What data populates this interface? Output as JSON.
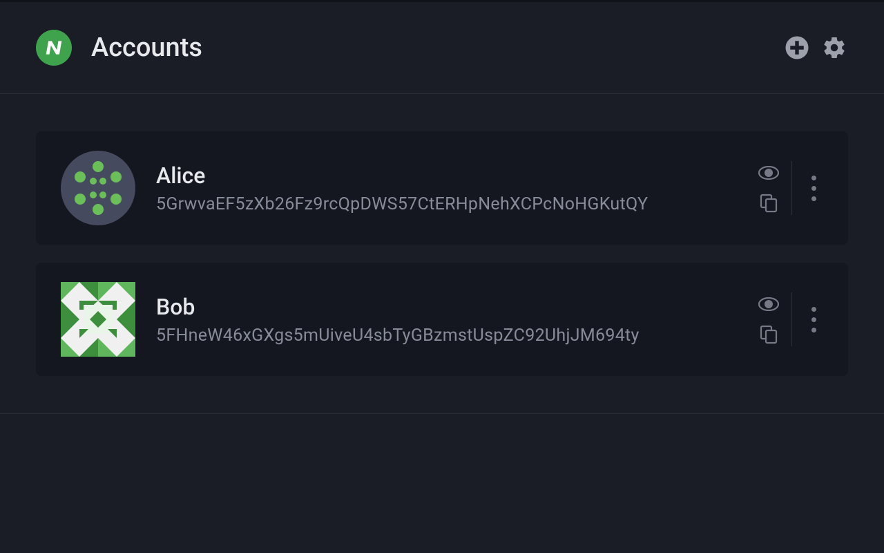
{
  "header": {
    "title": "Accounts"
  },
  "accounts": [
    {
      "name": "Alice",
      "address": "5GrwvaEF5zXb26Fz9rcQpDWS57CtERHpNehXCPcNoHGKutQY"
    },
    {
      "name": "Bob",
      "address": "5FHneW46xGXgs5mUiveU4sbTyGBzmstUspZC92UhjJM694ty"
    }
  ]
}
